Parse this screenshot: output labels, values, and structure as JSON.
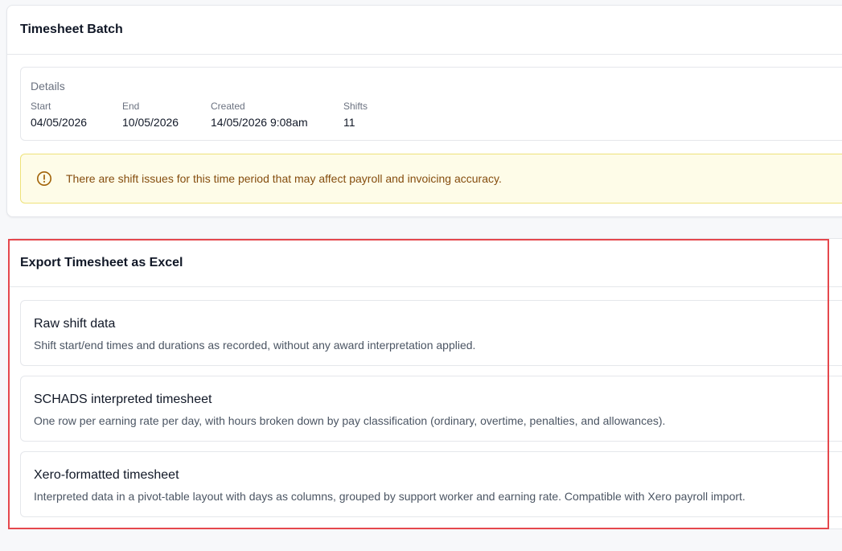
{
  "batch": {
    "title": "Timesheet Batch",
    "details": {
      "heading": "Details",
      "fields": [
        {
          "label": "Start",
          "value": "04/05/2026"
        },
        {
          "label": "End",
          "value": "10/05/2026"
        },
        {
          "label": "Created",
          "value": "14/05/2026 9:08am"
        },
        {
          "label": "Shifts",
          "value": "11"
        }
      ]
    },
    "warning": {
      "icon": "alert-circle-icon",
      "text": "There are shift issues for this time period that may affect payroll and invoicing accuracy.",
      "color": "#854d0e",
      "background": "#fefce8"
    }
  },
  "export": {
    "title": "Export Timesheet as Excel",
    "highlight_color": "#e5484d",
    "options": [
      {
        "title": "Raw shift data",
        "description": "Shift start/end times and durations as recorded, without any award interpretation applied."
      },
      {
        "title": "SCHADS interpreted timesheet",
        "description": "One row per earning rate per day, with hours broken down by pay classification (ordinary, overtime, penalties, and allowances)."
      },
      {
        "title": "Xero-formatted timesheet",
        "description": "Interpreted data in a pivot-table layout with days as columns, grouped by support worker and earning rate. Compatible with Xero payroll import."
      }
    ]
  }
}
